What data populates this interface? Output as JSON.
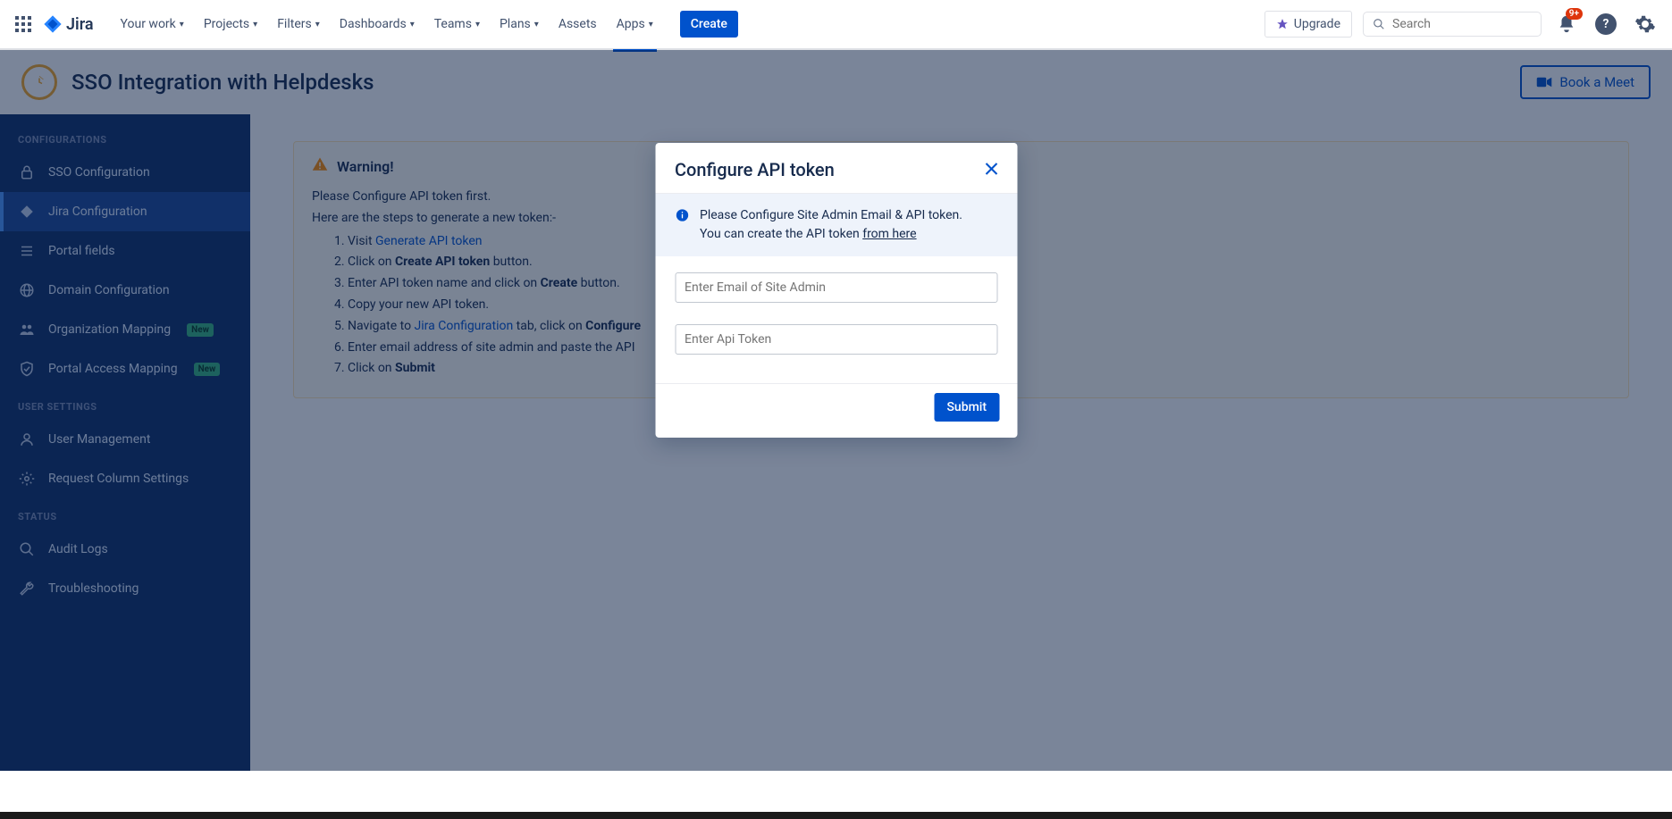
{
  "topnav": {
    "product": "Jira",
    "items": [
      "Your work",
      "Projects",
      "Filters",
      "Dashboards",
      "Teams",
      "Plans",
      "Assets",
      "Apps"
    ],
    "active_index": 7,
    "no_chevron_indices": [
      6
    ],
    "create": "Create",
    "upgrade": "Upgrade",
    "search_placeholder": "Search",
    "notif_badge": "9+"
  },
  "page": {
    "title": "SSO Integration with Helpdesks",
    "book_meet": "Book a Meet"
  },
  "sidebar": {
    "sections": [
      {
        "title": "CONFIGURATIONS",
        "items": [
          {
            "label": "SSO Configuration",
            "icon": "lock"
          },
          {
            "label": "Jira Configuration",
            "icon": "jira",
            "active": true
          },
          {
            "label": "Portal fields",
            "icon": "list"
          },
          {
            "label": "Domain Configuration",
            "icon": "globe"
          },
          {
            "label": "Organization Mapping",
            "icon": "users",
            "badge": "New"
          },
          {
            "label": "Portal Access Mapping",
            "icon": "shield",
            "badge": "New"
          }
        ]
      },
      {
        "title": "USER SETTINGS",
        "items": [
          {
            "label": "User Management",
            "icon": "user"
          },
          {
            "label": "Request Column Settings",
            "icon": "gear"
          }
        ]
      },
      {
        "title": "STATUS",
        "items": [
          {
            "label": "Audit Logs",
            "icon": "search"
          },
          {
            "label": "Troubleshooting",
            "icon": "wrench"
          }
        ]
      }
    ]
  },
  "warning": {
    "title": "Warning!",
    "intro1": "Please Configure API token first.",
    "intro2": "Here are the steps to generate a new token:-",
    "steps": {
      "s1_a": "Visit ",
      "s1_link": "Generate API token",
      "s2_a": "Click on ",
      "s2_b": "Create API token",
      "s2_c": " button.",
      "s3_a": "Enter API token name and click on ",
      "s3_b": "Create",
      "s3_c": " button.",
      "s4": "Copy your new API token.",
      "s5_a": "Navigate to ",
      "s5_link": "Jira Configuration",
      "s5_b": " tab, click on ",
      "s5_c": "Configure",
      "s6": "Enter email address of site admin and paste the API",
      "s7_a": "Click on ",
      "s7_b": "Submit"
    }
  },
  "modal": {
    "title": "Configure API token",
    "info1": "Please Configure Site Admin Email & API token.",
    "info2_a": "You can create the API token ",
    "info2_link": "from here",
    "email_placeholder": "Enter Email of Site Admin",
    "token_placeholder": "Enter Api Token",
    "submit": "Submit"
  }
}
